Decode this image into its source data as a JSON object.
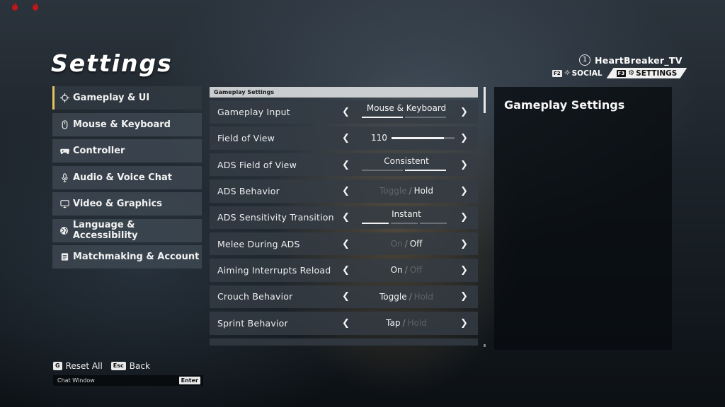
{
  "app": {
    "title": "Settings"
  },
  "status_icons": [
    "flame-icon",
    "flame-icon"
  ],
  "user": {
    "level": "1",
    "name": "HeartBreaker_TV"
  },
  "topnav": {
    "social": {
      "key": "F2",
      "label": "SOCIAL",
      "icon": "social-icon"
    },
    "settings": {
      "key": "F3",
      "label": "SETTINGS",
      "icon": "gear-icon"
    }
  },
  "sidebar": {
    "items": [
      {
        "label": "Gameplay & UI",
        "icon": "crosshair-icon",
        "active": true
      },
      {
        "label": "Mouse & Keyboard",
        "icon": "mouse-icon",
        "active": false
      },
      {
        "label": "Controller",
        "icon": "gamepad-icon",
        "active": false
      },
      {
        "label": "Audio & Voice Chat",
        "icon": "microphone-icon",
        "active": false
      },
      {
        "label": "Video & Graphics",
        "icon": "monitor-icon",
        "active": false
      },
      {
        "label": "Language & Accessibility",
        "icon": "globe-icon",
        "active": false
      },
      {
        "label": "Matchmaking & Account",
        "icon": "account-icon",
        "active": false
      }
    ]
  },
  "section": {
    "header": "Gameplay Settings"
  },
  "settings": {
    "gameplay_input": {
      "label": "Gameplay Input",
      "value": "Mouse & Keyboard",
      "options_count": 2,
      "selected_index": 0
    },
    "field_of_view": {
      "label": "Field of View",
      "value": "110",
      "slider_fraction": 0.83
    },
    "ads_fov": {
      "label": "ADS Field of View",
      "value": "Consistent",
      "options_count": 2,
      "selected_index": 1
    },
    "ads_behavior": {
      "label": "ADS Behavior",
      "opt_a": "Toggle",
      "sep": "/",
      "opt_b": "Hold",
      "selected": "Hold"
    },
    "ads_sensitivity_transition": {
      "label": "ADS Sensitivity Transition",
      "value": "Instant",
      "options_count": 3,
      "selected_index": 0
    },
    "melee_during_ads": {
      "label": "Melee During ADS",
      "opt_a": "On",
      "sep": "/",
      "opt_b": "Off",
      "selected": "Off"
    },
    "aiming_interrupts_reload": {
      "label": "Aiming Interrupts Reload",
      "opt_a": "On",
      "sep": "/",
      "opt_b": "Off",
      "selected": "On"
    },
    "crouch_behavior": {
      "label": "Crouch Behavior",
      "opt_a": "Toggle",
      "sep": "/",
      "opt_b": "Hold",
      "selected": "Toggle"
    },
    "sprint_behavior": {
      "label": "Sprint Behavior",
      "opt_a": "Tap",
      "sep": "/",
      "opt_b": "Hold",
      "selected": "Tap"
    }
  },
  "description": {
    "title": "Gameplay Settings"
  },
  "footer": {
    "reset": {
      "key": "G",
      "label": "Reset All"
    },
    "back": {
      "key": "Esc",
      "label": "Back"
    },
    "chat": {
      "placeholder": "Chat Window",
      "key": "Enter"
    }
  },
  "colors": {
    "accent": "#e6c35a",
    "panel": "#343c44",
    "description_panel": "#080c10"
  }
}
